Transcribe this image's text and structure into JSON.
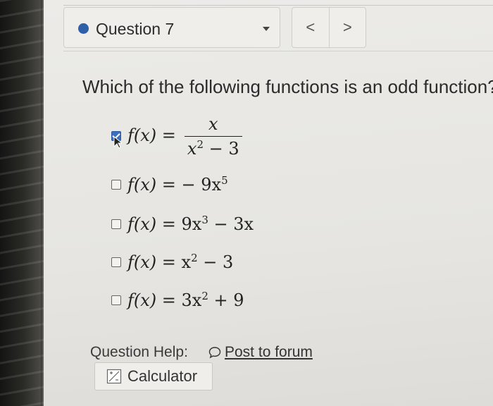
{
  "header": {
    "question_label": "Question 7",
    "prev_label": "<",
    "next_label": ">"
  },
  "question": {
    "text": "Which of the following functions is an odd function?"
  },
  "options": [
    {
      "lhs": "f(x) =",
      "numerator": "x",
      "denominator_base": "x",
      "denominator_exp": "2",
      "denominator_rest": " − 3",
      "checked": true
    },
    {
      "lhs": "f(x) =",
      "rhs_a": " − 9x",
      "exp": "5",
      "rhs_b": "",
      "checked": false
    },
    {
      "lhs": "f(x) =",
      "rhs_a": " 9x",
      "exp": "3",
      "rhs_b": " − 3x",
      "checked": false
    },
    {
      "lhs": "f(x) =",
      "rhs_a": " x",
      "exp": "2",
      "rhs_b": " − 3",
      "checked": false
    },
    {
      "lhs": "f(x) =",
      "rhs_a": " 3x",
      "exp": "2",
      "rhs_b": " + 9",
      "checked": false
    }
  ],
  "help": {
    "label": "Question Help:",
    "forum_link": "Post to forum",
    "calculator": "Calculator"
  },
  "colors": {
    "status_dot": "#2f5fa8",
    "checkbox_checked": "#3a6fc2"
  },
  "icons": [
    "status-dot-icon",
    "chevron-down-icon",
    "chevron-left-icon",
    "chevron-right-icon",
    "checkbox-icon",
    "cursor-icon",
    "speech-bubble-icon",
    "calculator-icon"
  ]
}
